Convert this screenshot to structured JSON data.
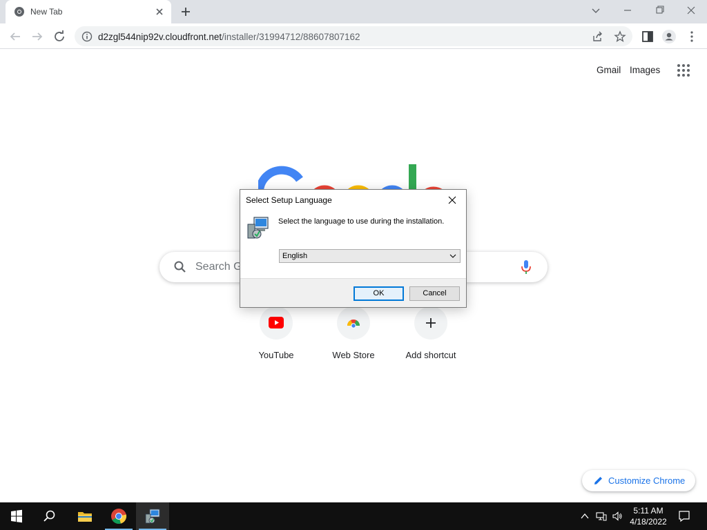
{
  "browser": {
    "tab": {
      "title": "New Tab"
    },
    "address": {
      "host": "d2zgl544nip92v.cloudfront.net",
      "path": "/installer/31994712/88607807162"
    }
  },
  "ntp": {
    "header_links": {
      "gmail": "Gmail",
      "images": "Images"
    },
    "search_placeholder": "Search Google or type a URL",
    "shortcuts": [
      {
        "label": "YouTube",
        "icon": "youtube-icon"
      },
      {
        "label": "Web Store",
        "icon": "web-store-icon"
      },
      {
        "label": "Add shortcut",
        "icon": "plus-icon"
      }
    ],
    "customize_label": "Customize Chrome"
  },
  "dialog": {
    "title": "Select Setup Language",
    "message": "Select the language to use during the installation.",
    "language_selected": "English",
    "ok_label": "OK",
    "cancel_label": "Cancel"
  },
  "taskbar": {
    "time": "5:11 AM",
    "date": "4/18/2022"
  },
  "colors": {
    "accent_blue": "#1a73e8",
    "google_blue": "#4285f4",
    "google_red": "#ea4335",
    "google_yellow": "#fbbc05",
    "google_green": "#34a853",
    "dialog_focus": "#0078d7"
  }
}
